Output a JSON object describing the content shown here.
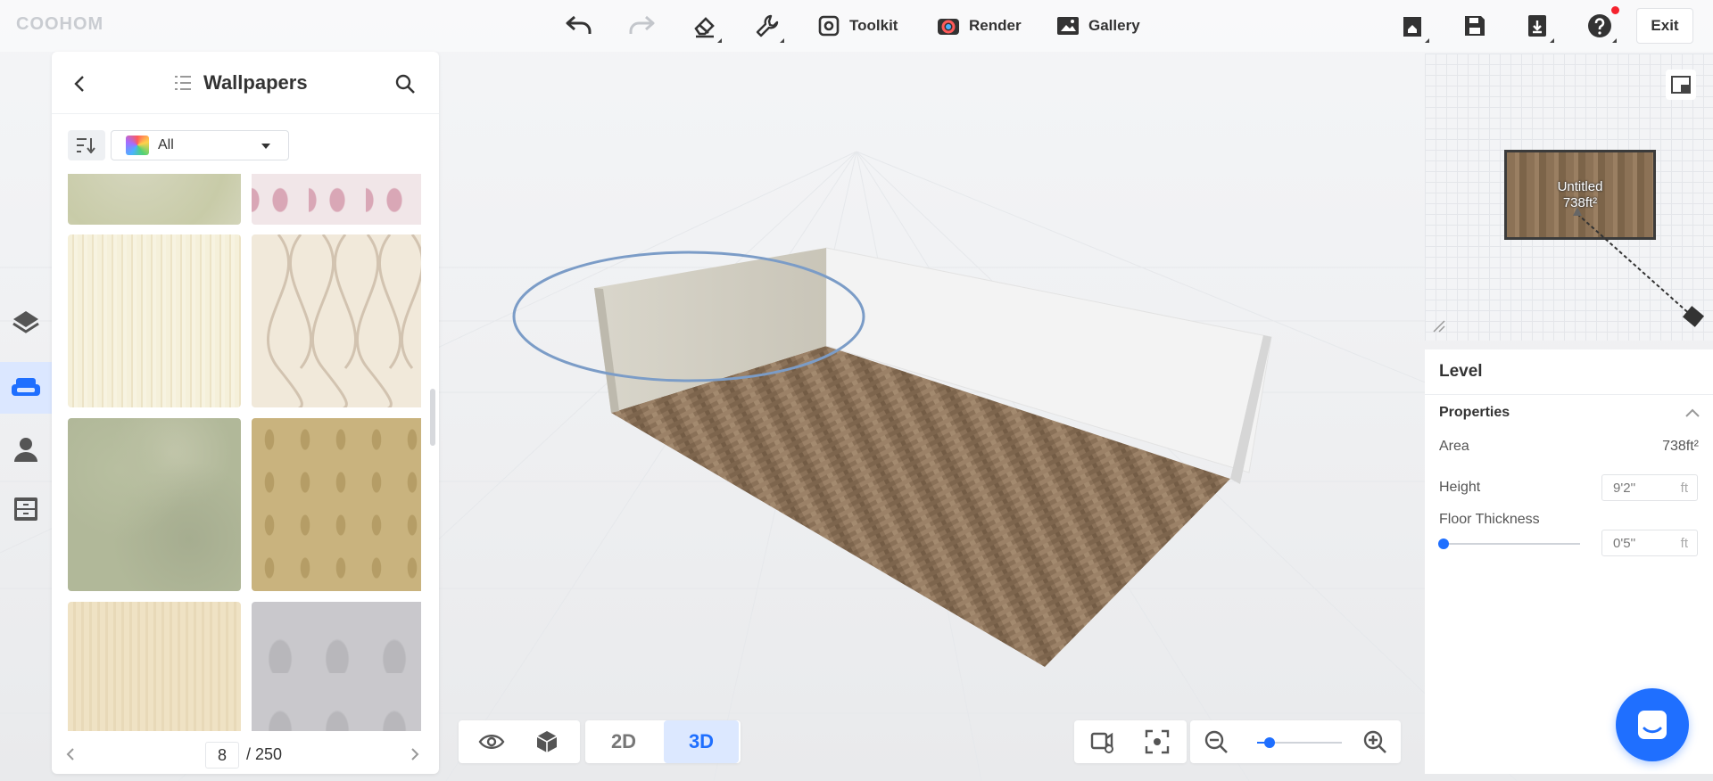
{
  "app": {
    "logo": "COOHOM"
  },
  "toolbar": {
    "toolkit_label": "Toolkit",
    "render_label": "Render",
    "gallery_label": "Gallery",
    "exit_label": "Exit",
    "icons": [
      "undo-icon",
      "redo-icon",
      "eraser-icon",
      "wrench-icon",
      "home-icon",
      "save-icon",
      "export-icon",
      "help-icon"
    ],
    "accent_color": "#1f6fff",
    "notification_color": "#f5222d"
  },
  "sidebar": {
    "items": [
      {
        "name": "structure",
        "icon": "layers-icon",
        "active": false
      },
      {
        "name": "furniture",
        "icon": "sofa-icon",
        "active": true
      },
      {
        "name": "account",
        "icon": "user-icon",
        "active": false
      },
      {
        "name": "cabinet",
        "icon": "cabinet-icon",
        "active": false
      }
    ]
  },
  "panel": {
    "title": "Wallpapers",
    "filter_value": "All",
    "tiles": [
      {
        "name": "wallpaper-sage-plain"
      },
      {
        "name": "wallpaper-pink-damask"
      },
      {
        "name": "wallpaper-cream-stripes"
      },
      {
        "name": "wallpaper-beige-waves"
      },
      {
        "name": "wallpaper-green-mottled"
      },
      {
        "name": "wallpaper-gold-pattern"
      },
      {
        "name": "wallpaper-cream-texture"
      },
      {
        "name": "wallpaper-gray-floral"
      }
    ],
    "pager": {
      "current": "8",
      "total_label": "/ 250"
    }
  },
  "minimap": {
    "room_name": "Untitled",
    "room_area": "738ft²"
  },
  "properties": {
    "level_title": "Level",
    "section_title": "Properties",
    "area_label": "Area",
    "area_value": "738ft²",
    "height_label": "Height",
    "height_value": "9'2''",
    "floor_thickness_label": "Floor Thickness",
    "floor_thickness_value": "0'5''",
    "unit": "ft",
    "floor_thickness_slider_fraction": 0.0
  },
  "view_controls": {
    "mode_2d": "2D",
    "mode_3d": "3D",
    "active_mode": "3D",
    "zoom_fraction": 0.15
  }
}
